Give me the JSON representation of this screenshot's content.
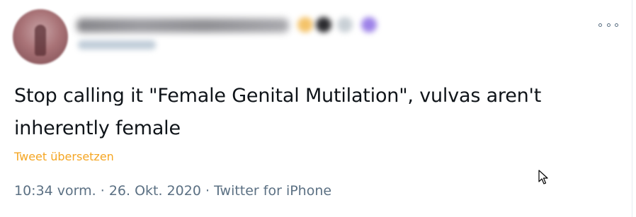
{
  "tweet": {
    "text_line_1": "Stop calling it \"Female Genital Mutilation\", vulvas aren't",
    "text_line_2": "inherently female",
    "translate_label": "Tweet übersetzen",
    "time": "10:34 vorm.",
    "date": "26. Okt. 2020",
    "source": "Twitter for iPhone",
    "separator": " · "
  },
  "icons": {
    "more": "more-horizontal-icon",
    "cursor": "mouse-pointer-icon"
  },
  "colors": {
    "text": "#0f1419",
    "secondary": "#5b7083",
    "translate_link": "#f5a623"
  }
}
